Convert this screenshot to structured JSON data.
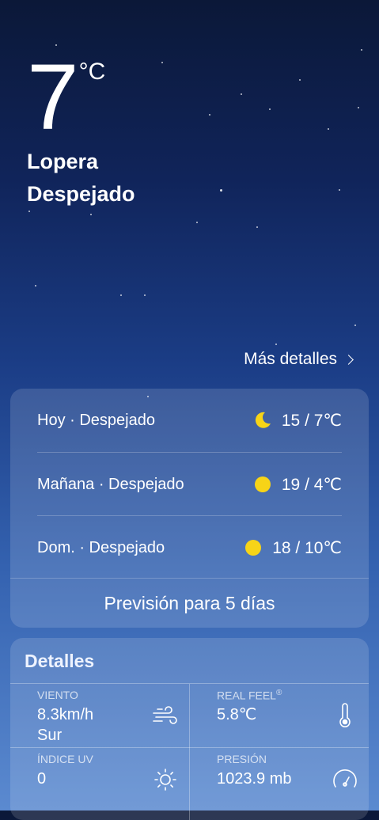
{
  "current": {
    "temperature": "7",
    "unit": "°C",
    "city": "Lopera",
    "condition": "Despejado"
  },
  "more_details": "Más detalles",
  "forecast": {
    "days": [
      {
        "label": "Hoy · Despejado",
        "icon": "moon-icon",
        "hilo": "15 / 7℃"
      },
      {
        "label": "Mañana · Despejado",
        "icon": "sun-icon",
        "hilo": "19 / 4℃"
      },
      {
        "label": "Dom. · Despejado",
        "icon": "sun-icon",
        "hilo": "18 / 10℃"
      }
    ],
    "five_day_button": "Previsión para 5 días"
  },
  "details": {
    "title": "Detalles",
    "wind": {
      "label": "VIENTO",
      "speed": "8.3km/h",
      "direction": "Sur",
      "icon": "wind-icon"
    },
    "real_feel": {
      "label": "REAL FEEL",
      "mark": "®",
      "value": "5.8℃",
      "icon": "thermometer-icon"
    },
    "uv": {
      "label": "ÍNDICE UV",
      "value": "0",
      "icon": "sun-outline-icon"
    },
    "pressure": {
      "label": "PRESIÓN",
      "value": "1023.9 mb",
      "icon": "gauge-icon"
    }
  },
  "colors": {
    "sun": "#f7d417",
    "sky_top": "#0b1838",
    "sky_bottom": "#5b8ad0"
  }
}
